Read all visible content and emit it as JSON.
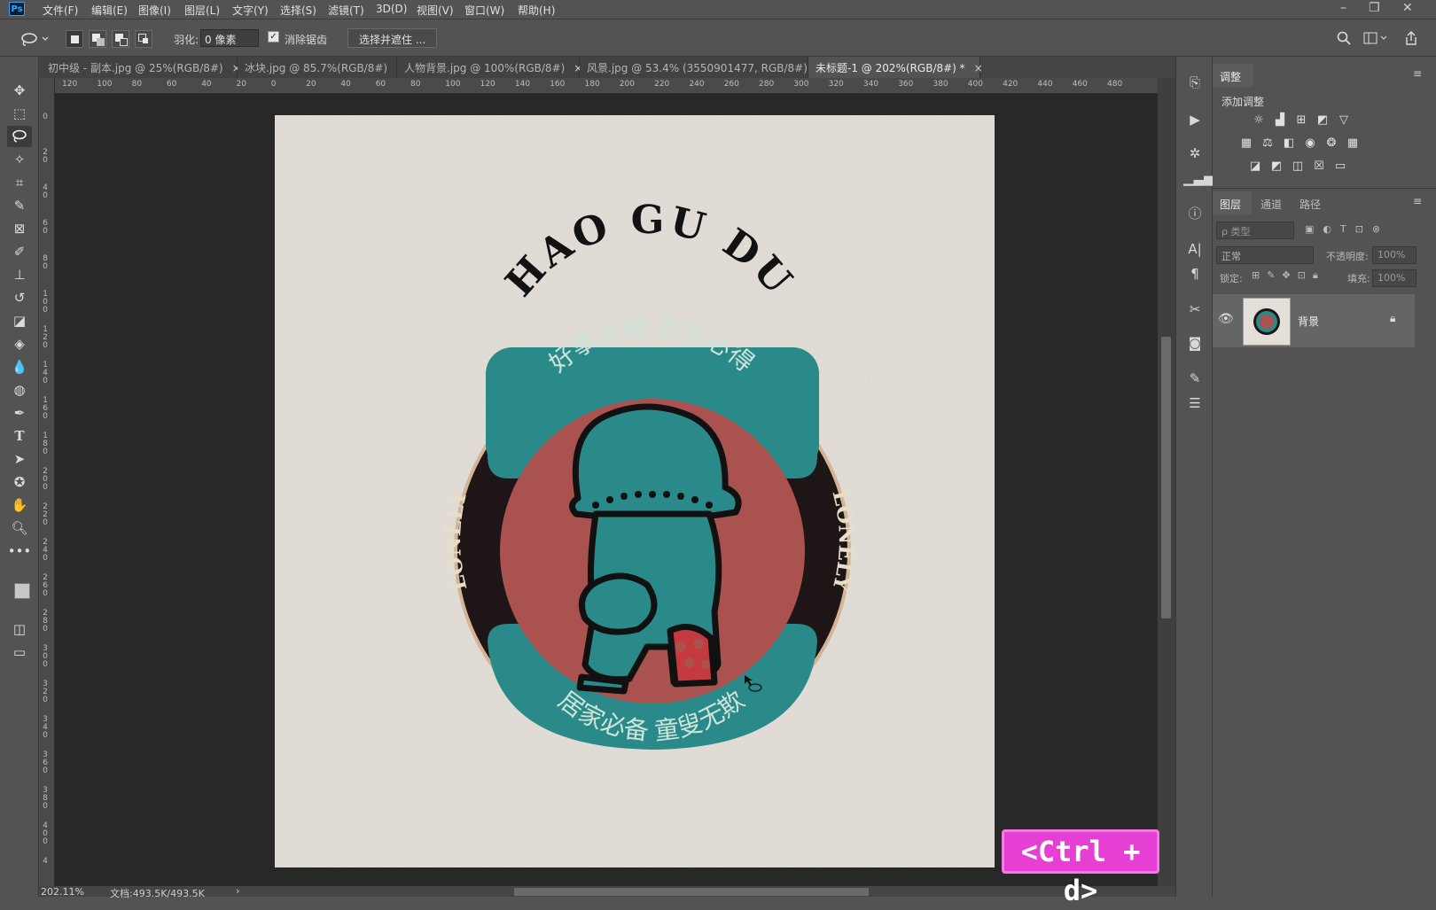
{
  "app": {
    "logo": "Ps"
  },
  "menu": [
    "文件(F)",
    "编辑(E)",
    "图像(I)",
    "图层(L)",
    "文字(Y)",
    "选择(S)",
    "滤镜(T)",
    "3D(D)",
    "视图(V)",
    "窗口(W)",
    "帮助(H)"
  ],
  "window_controls": {
    "minimize": "–",
    "restore": "❐",
    "close": "✕"
  },
  "options": {
    "feather_label": "羽化:",
    "feather_value": "0 像素",
    "antialias_checked": true,
    "antialias_label": "消除锯齿",
    "select_mask_label": "选择并遮住 ..."
  },
  "tabs": [
    {
      "label": "初中级 - 副本.jpg @ 25%(RGB/8#)",
      "active": false
    },
    {
      "label": "冰块.jpg @ 85.7%(RGB/8#)",
      "active": false
    },
    {
      "label": "人物背景.jpg @ 100%(RGB/8#)",
      "active": false
    },
    {
      "label": "风景.jpg @ 53.4% (3550901477, RGB/8#) *",
      "active": false
    },
    {
      "label": "未标题-1 @ 202%(RGB/8#) *",
      "active": true
    }
  ],
  "tab_close": "×",
  "ruler_h": [
    "120",
    "100",
    "80",
    "60",
    "40",
    "20",
    "0",
    "20",
    "40",
    "60",
    "80",
    "100",
    "120",
    "140",
    "160",
    "180",
    "200",
    "220",
    "240",
    "260",
    "280",
    "300",
    "320",
    "340",
    "360",
    "380",
    "400",
    "420",
    "440",
    "460",
    "480"
  ],
  "ruler_v": [
    "0",
    "2 0",
    "4 0",
    "6 0",
    "8 0",
    "1 0 0",
    "1 2 0",
    "1 4 0",
    "1 6 0",
    "1 8 0",
    "2 0 0",
    "2 2 0",
    "2 4 0",
    "2 6 0",
    "2 8 0",
    "3 0 0",
    "3 2 0",
    "3 4 0",
    "3 6 0",
    "3 8 0",
    "4 0 0",
    "4"
  ],
  "artwork": {
    "title": "HAO GU DU",
    "top_text": "好事多磨  志在必得",
    "bottom_text": "居家必备  童叟无欺",
    "side_left": "LONELY",
    "side_right": "LONELY",
    "colors": {
      "teal": "#2a8a8a",
      "red": "#a9524f",
      "dark": "#1e1616",
      "paper": "#e4e0d9"
    }
  },
  "status": {
    "zoom": "202.11%",
    "doc": "文档:493.5K/493.5K"
  },
  "shortcut_badge": "<Ctrl + d>",
  "panels": {
    "adjust_tab": "调整",
    "add_adjust": "添加调整",
    "layer_tabs": [
      "图层",
      "通道",
      "路径"
    ],
    "kind_placeholder": "ρ 类型",
    "blend_mode": "正常",
    "opacity_label": "不透明度:",
    "opacity_value": "100%",
    "lock_label": "锁定:",
    "fill_label": "填充:",
    "fill_value": "100%",
    "layer_name": "背景"
  },
  "icons": {
    "lasso": "lasso-icon",
    "move": "move-icon",
    "visibility": "eye-icon",
    "lock": "lock-icon"
  }
}
